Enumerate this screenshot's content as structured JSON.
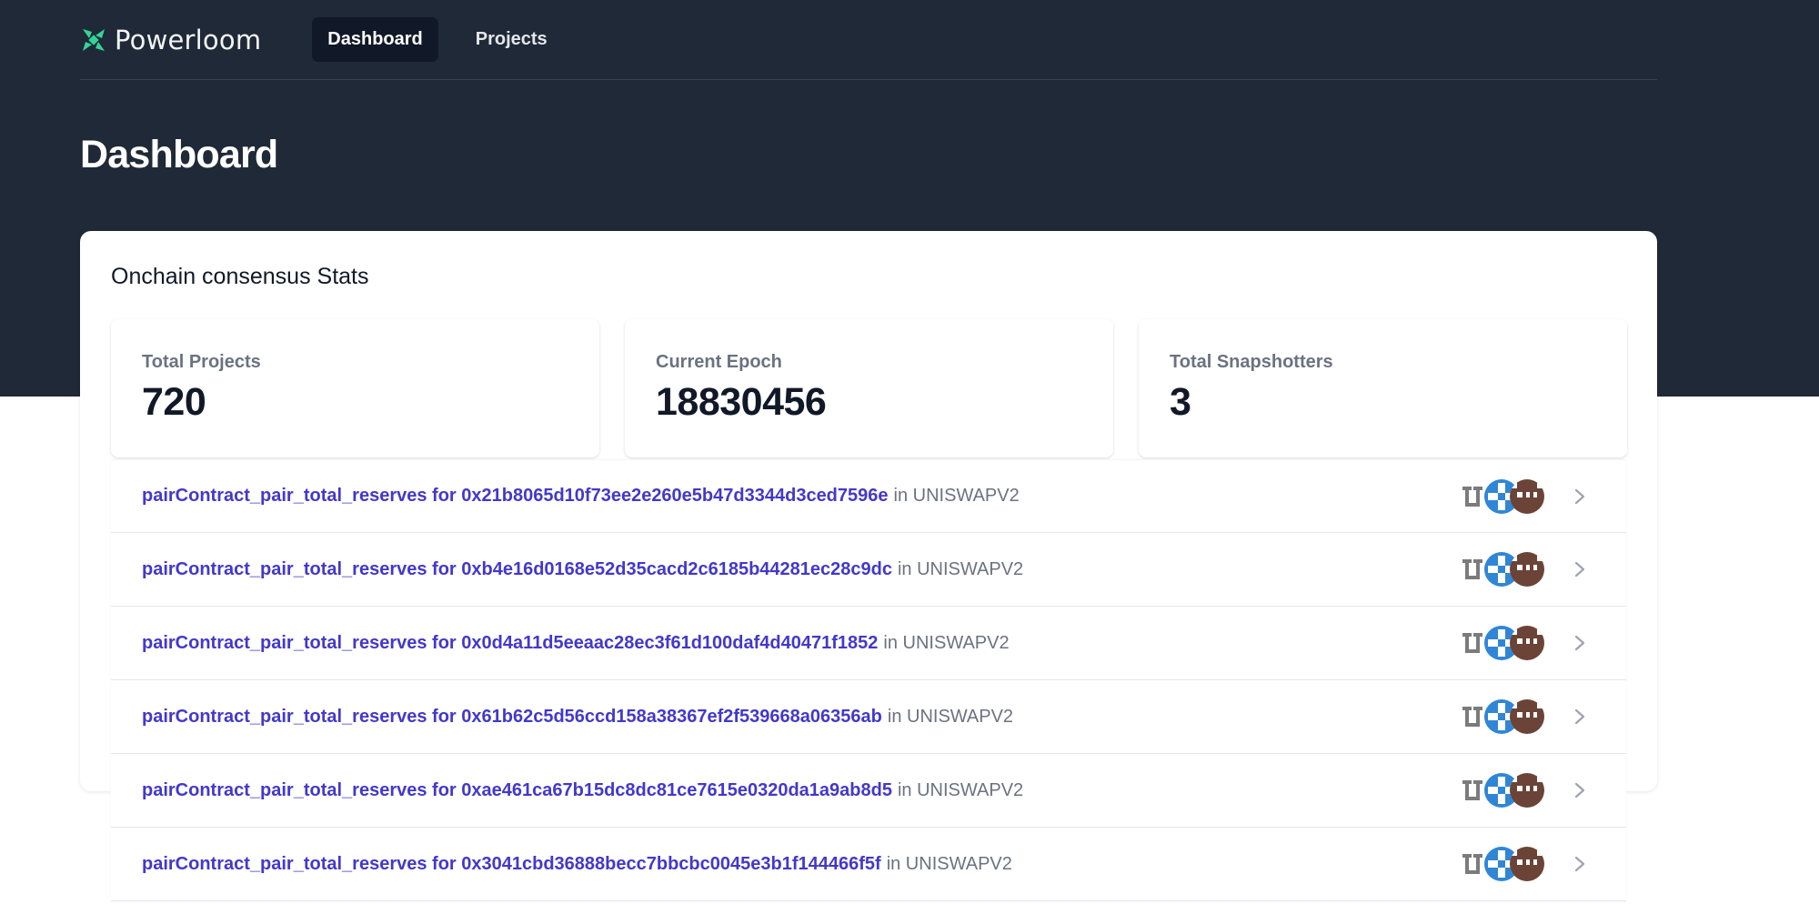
{
  "brand": {
    "name": "Powerloom",
    "accent": "#34d399"
  },
  "nav": {
    "items": [
      {
        "label": "Dashboard",
        "active": true
      },
      {
        "label": "Projects",
        "active": false
      }
    ]
  },
  "page": {
    "title": "Dashboard"
  },
  "stats": {
    "title": "Onchain consensus Stats",
    "cards": [
      {
        "label": "Total Projects",
        "value": "720"
      },
      {
        "label": "Current Epoch",
        "value": "18830456"
      },
      {
        "label": "Total Snapshotters",
        "value": "3"
      }
    ]
  },
  "projects": [
    {
      "title": "pairContract_pair_total_reserves for 0x21b8065d10f73ee2e260e5b47d3344d3ced7596e",
      "suffix": "in UNISWAPV2"
    },
    {
      "title": "pairContract_pair_total_reserves for 0xb4e16d0168e52d35cacd2c6185b44281ec28c9dc",
      "suffix": "in UNISWAPV2"
    },
    {
      "title": "pairContract_pair_total_reserves for 0x0d4a11d5eeaac28ec3f61d100daf4d40471f1852",
      "suffix": "in UNISWAPV2"
    },
    {
      "title": "pairContract_pair_total_reserves for 0x61b62c5d56ccd158a38367ef2f539668a06356ab",
      "suffix": "in UNISWAPV2"
    },
    {
      "title": "pairContract_pair_total_reserves for 0xae461ca67b15dc8dc81ce7615e0320da1a9ab8d5",
      "suffix": "in UNISWAPV2"
    },
    {
      "title": "pairContract_pair_total_reserves for 0x3041cbd36888becc7bbcbc0045e3b1f144466f5f",
      "suffix": "in UNISWAPV2"
    }
  ],
  "avatar_colors": [
    "#7b7b7b",
    "#2f86d6",
    "#6b4437"
  ],
  "icons": {
    "row_action": "chevron-right-icon",
    "logo": "powerloom-logo-icon"
  }
}
